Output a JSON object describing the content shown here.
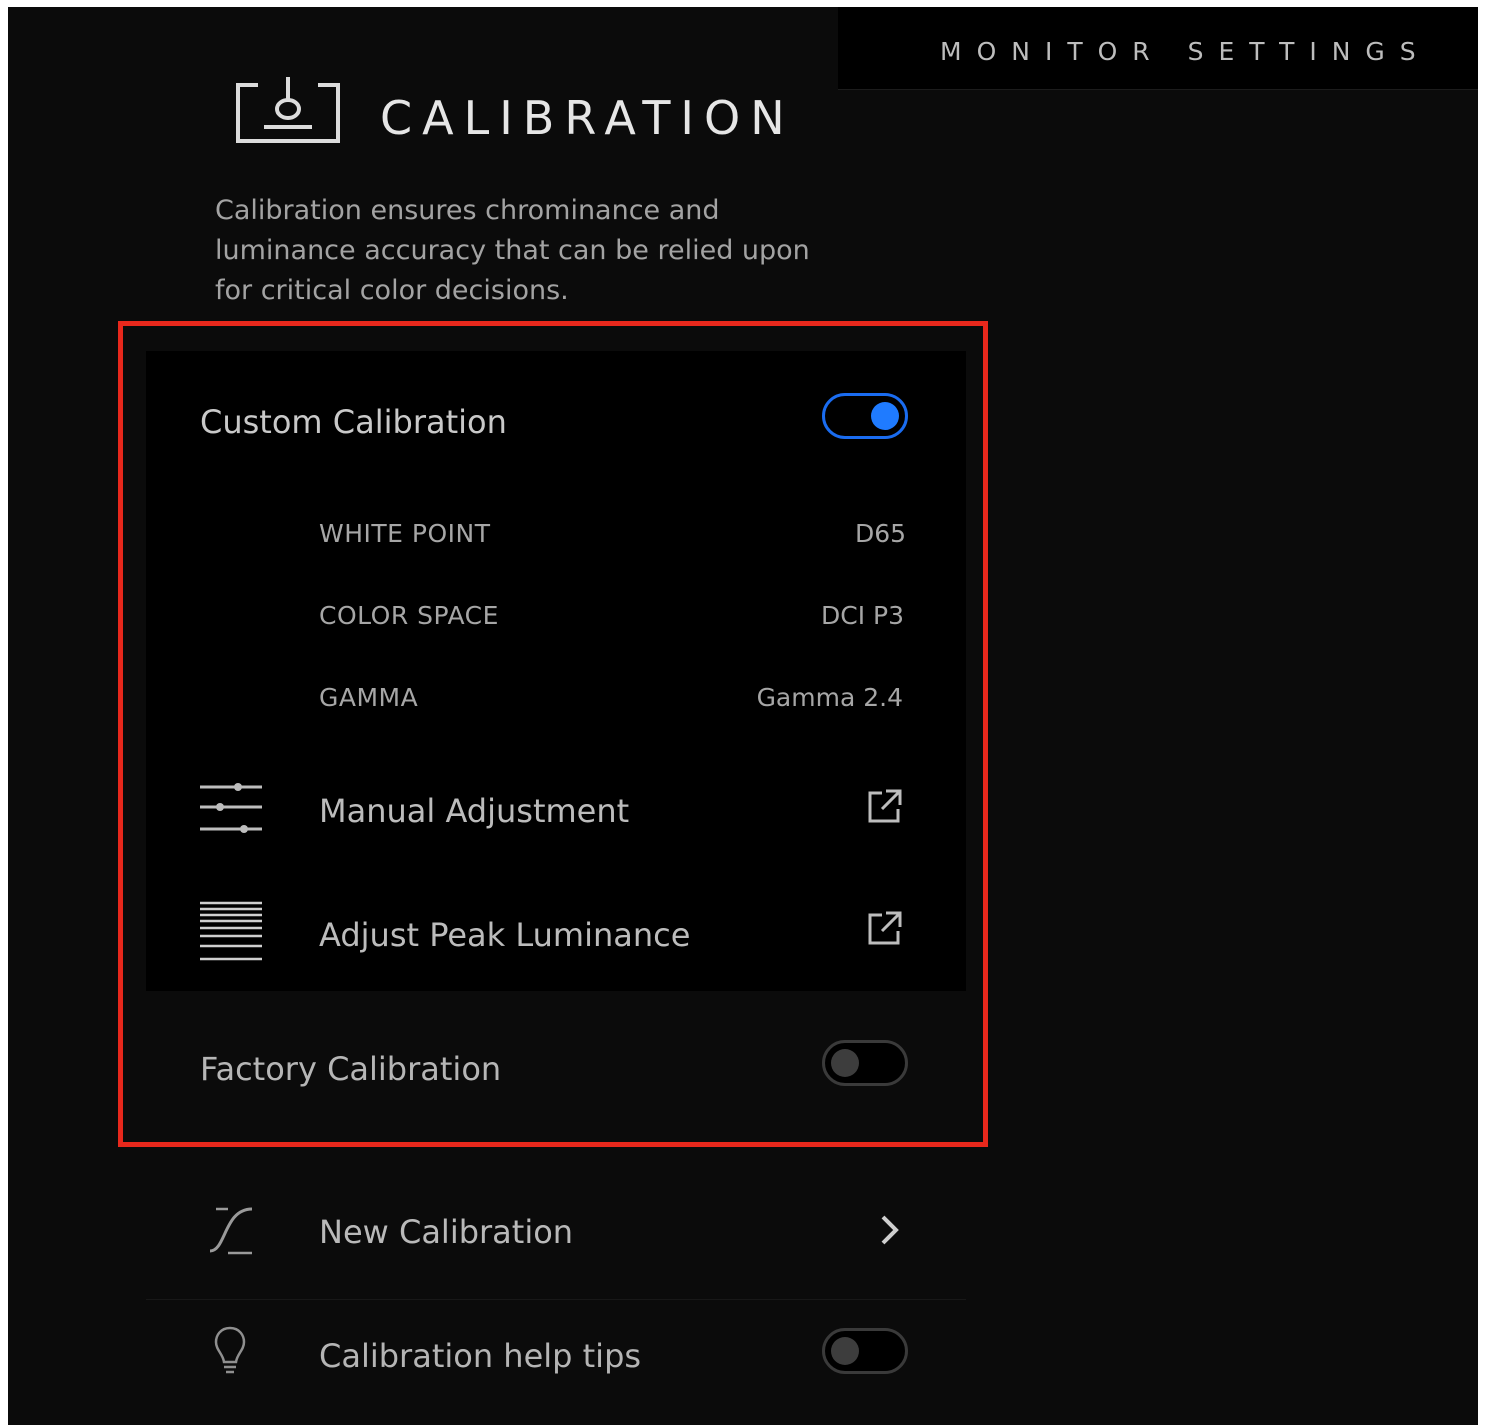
{
  "header": {
    "section_title": "MONITOR SETTINGS",
    "page_title": "CALIBRATION",
    "description": "Calibration ensures chrominance and luminance accuracy that can be relied upon for critical color decisions."
  },
  "custom_calibration": {
    "label": "Custom Calibration",
    "enabled": true,
    "settings": [
      {
        "label": "WHITE POINT",
        "value": "D65"
      },
      {
        "label": "COLOR SPACE",
        "value": "DCI P3"
      },
      {
        "label": "GAMMA",
        "value": "Gamma 2.4"
      }
    ],
    "manual_adjustment": {
      "label": "Manual Adjustment",
      "icon": "sliders-icon",
      "action_icon": "external-link-icon"
    },
    "peak_luminance": {
      "label": "Adjust Peak Luminance",
      "icon": "luminance-lines-icon",
      "action_icon": "external-link-icon"
    }
  },
  "factory_calibration": {
    "label": "Factory Calibration",
    "enabled": false
  },
  "new_calibration": {
    "label": "New Calibration",
    "icon": "curve-icon",
    "action_icon": "chevron-right-icon"
  },
  "help_tips": {
    "label": "Calibration help tips",
    "icon": "lightbulb-icon",
    "enabled": false
  },
  "colors": {
    "background": "#0b0b0b",
    "panel": "#000000",
    "accent": "#1f7bff",
    "highlight": "#e8281c"
  }
}
